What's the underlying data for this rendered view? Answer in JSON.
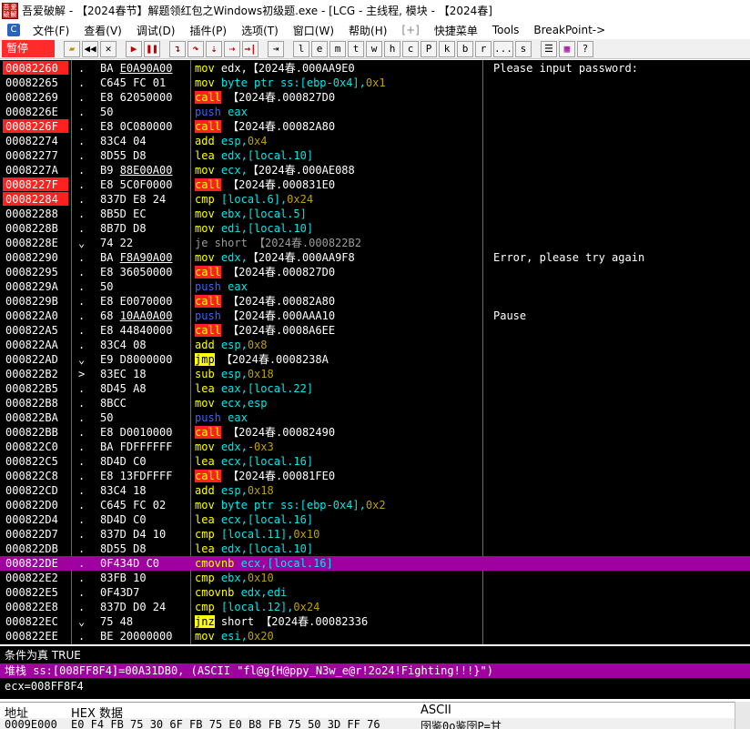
{
  "window": {
    "title": "吾爱破解 - 【2024春节】解题领红包之Windows初级题.exe - [LCG - 主线程, 模块 - 【2024春]",
    "logo_text": [
      "吾",
      "爱",
      "破",
      "解"
    ]
  },
  "menu": {
    "items": [
      "文件(F)",
      "查看(V)",
      "调试(D)",
      "插件(P)",
      "选项(T)",
      "窗口(W)",
      "帮助(H)",
      "[+]",
      "快捷菜单",
      "Tools",
      "BreakPoint->"
    ]
  },
  "toolbar": {
    "status": "暂停",
    "letters": [
      "l",
      "e",
      "m",
      "t",
      "w",
      "h",
      "c",
      "P",
      "k",
      "b",
      "r",
      "...",
      "s"
    ]
  },
  "disasm": {
    "rows": [
      {
        "addr": "00082260",
        "mark": ".",
        "hex": "BA E0A90A00",
        "hex_u": "E0A90A00",
        "mn": "mov",
        "mcls": "",
        "ops": [
          [
            "edx,",
            "w"
          ],
          [
            "【2024春.000AA9E0",
            "w"
          ]
        ],
        "comment": "Please input password:",
        "bp": true
      },
      {
        "addr": "00082265",
        "mark": ".",
        "hex": "C645 FC 01",
        "mn": "mov",
        "mcls": "",
        "ops": [
          [
            "byte ptr ss:[ebp-0x4],",
            "o"
          ],
          [
            "0x1",
            "n"
          ]
        ],
        "comment": ""
      },
      {
        "addr": "00082269",
        "mark": ".",
        "hex": "E8 62050000",
        "mn": "call",
        "mcls": "call",
        "ops": [
          [
            "【2024春.000827D0",
            "w"
          ]
        ],
        "comment": ""
      },
      {
        "addr": "0008226E",
        "mark": ".",
        "hex": "50",
        "mn": "push",
        "mcls": "push",
        "ops": [
          [
            "eax",
            "o"
          ]
        ],
        "comment": ""
      },
      {
        "addr": "0008226F",
        "mark": ".",
        "hex": "E8 0C080000",
        "mn": "call",
        "mcls": "call",
        "ops": [
          [
            "【2024春.00082A80",
            "w"
          ]
        ],
        "comment": "",
        "bp": true
      },
      {
        "addr": "00082274",
        "mark": ".",
        "hex": "83C4 04",
        "mn": "add",
        "mcls": "",
        "ops": [
          [
            "esp,",
            "o"
          ],
          [
            "0x4",
            "n"
          ]
        ],
        "comment": ""
      },
      {
        "addr": "00082277",
        "mark": ".",
        "hex": "8D55 D8",
        "mn": "lea",
        "mcls": "",
        "ops": [
          [
            "edx,[local.10]",
            "o"
          ]
        ],
        "comment": ""
      },
      {
        "addr": "0008227A",
        "mark": ".",
        "hex": "B9 88E00A00",
        "hex_u": "88E00A00",
        "mn": "mov",
        "mcls": "",
        "ops": [
          [
            "ecx,",
            "o"
          ],
          [
            "【2024春.000AE088",
            "w"
          ]
        ],
        "comment": ""
      },
      {
        "addr": "0008227F",
        "mark": ".",
        "hex": "E8 5C0F0000",
        "mn": "call",
        "mcls": "call",
        "ops": [
          [
            "【2024春.000831E0",
            "w"
          ]
        ],
        "comment": "",
        "bp": true
      },
      {
        "addr": "00082284",
        "mark": ".",
        "hex": "837D E8 24",
        "mn": "cmp",
        "mcls": "",
        "ops": [
          [
            "[local.6],",
            "o"
          ],
          [
            "0x24",
            "n"
          ]
        ],
        "comment": "",
        "bp": true
      },
      {
        "addr": "00082288",
        "mark": ".",
        "hex": "8B5D EC",
        "mn": "mov",
        "mcls": "",
        "ops": [
          [
            "ebx,[local.5]",
            "o"
          ]
        ],
        "comment": ""
      },
      {
        "addr": "0008228B",
        "mark": ".",
        "hex": "8B7D D8",
        "mn": "mov",
        "mcls": "",
        "ops": [
          [
            "edi,[local.10]",
            "o"
          ]
        ],
        "comment": ""
      },
      {
        "addr": "0008228E",
        "mark": "⌄",
        "hex": "74 22",
        "mn": "je short",
        "mcls": "je",
        "ops": [
          [
            "【2024春.000822B2",
            "g"
          ]
        ],
        "comment": ""
      },
      {
        "addr": "00082290",
        "mark": ".",
        "hex": "BA F8A90A00",
        "hex_u": "F8A90A00",
        "mn": "mov",
        "mcls": "",
        "ops": [
          [
            "edx,",
            "o"
          ],
          [
            "【2024春.000AA9F8",
            "w"
          ]
        ],
        "comment": "Error, please try again"
      },
      {
        "addr": "00082295",
        "mark": ".",
        "hex": "E8 36050000",
        "mn": "call",
        "mcls": "call",
        "ops": [
          [
            "【2024春.000827D0",
            "w"
          ]
        ],
        "comment": ""
      },
      {
        "addr": "0008229A",
        "mark": ".",
        "hex": "50",
        "mn": "push",
        "mcls": "push",
        "ops": [
          [
            "eax",
            "o"
          ]
        ],
        "comment": ""
      },
      {
        "addr": "0008229B",
        "mark": ".",
        "hex": "E8 E0070000",
        "mn": "call",
        "mcls": "call",
        "ops": [
          [
            "【2024春.00082A80",
            "w"
          ]
        ],
        "comment": ""
      },
      {
        "addr": "000822A0",
        "mark": ".",
        "hex": "68 10AA0A00",
        "hex_u": "10AA0A00",
        "mn": "push",
        "mcls": "push",
        "ops": [
          [
            "【2024春.000AAA10",
            "w"
          ]
        ],
        "comment": "Pause"
      },
      {
        "addr": "000822A5",
        "mark": ".",
        "hex": "E8 44840000",
        "mn": "call",
        "mcls": "call",
        "ops": [
          [
            "【2024春.0008A6EE",
            "w"
          ]
        ],
        "comment": ""
      },
      {
        "addr": "000822AA",
        "mark": ".",
        "hex": "83C4 08",
        "mn": "add",
        "mcls": "",
        "ops": [
          [
            "esp,",
            "o"
          ],
          [
            "0x8",
            "n"
          ]
        ],
        "comment": ""
      },
      {
        "addr": "000822AD",
        "mark": "⌄",
        "hex": "E9 D8000000",
        "mn": "jmp",
        "mcls": "jmp",
        "ops": [
          [
            "【2024春.0008238A",
            "w"
          ]
        ],
        "comment": ""
      },
      {
        "addr": "000822B2",
        "mark": ">",
        "hex": "83EC 18",
        "mn": "sub",
        "mcls": "",
        "ops": [
          [
            "esp,",
            "o"
          ],
          [
            "0x18",
            "n"
          ]
        ],
        "comment": ""
      },
      {
        "addr": "000822B5",
        "mark": ".",
        "hex": "8D45 A8",
        "mn": "lea",
        "mcls": "",
        "ops": [
          [
            "eax,[local.22]",
            "o"
          ]
        ],
        "comment": ""
      },
      {
        "addr": "000822B8",
        "mark": ".",
        "hex": "8BCC",
        "mn": "mov",
        "mcls": "",
        "ops": [
          [
            "ecx,esp",
            "o"
          ]
        ],
        "comment": ""
      },
      {
        "addr": "000822BA",
        "mark": ".",
        "hex": "50",
        "mn": "push",
        "mcls": "push",
        "ops": [
          [
            "eax",
            "o"
          ]
        ],
        "comment": ""
      },
      {
        "addr": "000822BB",
        "mark": ".",
        "hex": "E8 D0010000",
        "mn": "call",
        "mcls": "call",
        "ops": [
          [
            "【2024春.00082490",
            "w"
          ]
        ],
        "comment": ""
      },
      {
        "addr": "000822C0",
        "mark": ".",
        "hex": "BA FDFFFFFF",
        "mn": "mov",
        "mcls": "",
        "ops": [
          [
            "edx,",
            "o"
          ],
          [
            "-0x3",
            "n"
          ]
        ],
        "comment": ""
      },
      {
        "addr": "000822C5",
        "mark": ".",
        "hex": "8D4D C0",
        "mn": "lea",
        "mcls": "",
        "ops": [
          [
            "ecx,[local.16]",
            "o"
          ]
        ],
        "comment": ""
      },
      {
        "addr": "000822C8",
        "mark": ".",
        "hex": "E8 13FDFFFF",
        "mn": "call",
        "mcls": "call",
        "ops": [
          [
            "【2024春.00081FE0",
            "w"
          ]
        ],
        "comment": ""
      },
      {
        "addr": "000822CD",
        "mark": ".",
        "hex": "83C4 18",
        "mn": "add",
        "mcls": "",
        "ops": [
          [
            "esp,",
            "o"
          ],
          [
            "0x18",
            "n"
          ]
        ],
        "comment": ""
      },
      {
        "addr": "000822D0",
        "mark": ".",
        "hex": "C645 FC 02",
        "mn": "mov",
        "mcls": "",
        "ops": [
          [
            "byte ptr ss:[ebp-0x4],",
            "o"
          ],
          [
            "0x2",
            "n"
          ]
        ],
        "comment": ""
      },
      {
        "addr": "000822D4",
        "mark": ".",
        "hex": "8D4D C0",
        "mn": "lea",
        "mcls": "",
        "ops": [
          [
            "ecx,[local.16]",
            "o"
          ]
        ],
        "comment": ""
      },
      {
        "addr": "000822D7",
        "mark": ".",
        "hex": "837D D4 10",
        "mn": "cmp",
        "mcls": "",
        "ops": [
          [
            "[local.11],",
            "o"
          ],
          [
            "0x10",
            "n"
          ]
        ],
        "comment": ""
      },
      {
        "addr": "000822DB",
        "mark": ".",
        "hex": "8D55 D8",
        "mn": "lea",
        "mcls": "",
        "ops": [
          [
            "edx,[local.10]",
            "o"
          ]
        ],
        "comment": ""
      },
      {
        "addr": "000822DE",
        "mark": ".",
        "hex": "0F434D C0",
        "mn": "cmovnb",
        "mcls": "",
        "ops": [
          [
            "ecx,[local.16]",
            "o"
          ]
        ],
        "comment": "",
        "sel": true
      },
      {
        "addr": "000822E2",
        "mark": ".",
        "hex": "83FB 10",
        "mn": "cmp",
        "mcls": "",
        "ops": [
          [
            "ebx,",
            "o"
          ],
          [
            "0x10",
            "n"
          ]
        ],
        "comment": ""
      },
      {
        "addr": "000822E5",
        "mark": ".",
        "hex": "0F43D7",
        "mn": "cmovnb",
        "mcls": "",
        "ops": [
          [
            "edx,edi",
            "o"
          ]
        ],
        "comment": ""
      },
      {
        "addr": "000822E8",
        "mark": ".",
        "hex": "837D D0 24",
        "mn": "cmp",
        "mcls": "",
        "ops": [
          [
            "[local.12],",
            "o"
          ],
          [
            "0x24",
            "n"
          ]
        ],
        "comment": ""
      },
      {
        "addr": "000822EC",
        "mark": "⌄",
        "hex": "75 48",
        "mn": "jnz",
        "mcls": "jcc",
        "ops": [
          [
            "short 【2024春.00082336",
            "w"
          ]
        ],
        "comment": ""
      },
      {
        "addr": "000822EE",
        "mark": ".",
        "hex": "BE 20000000",
        "mn": "mov",
        "mcls": "",
        "ops": [
          [
            "esi,",
            "o"
          ],
          [
            "0x20",
            "n"
          ]
        ],
        "comment": ""
      }
    ]
  },
  "info": {
    "condition": "条件为真 TRUE",
    "stack": "堆栈 ss:[008FF8F4]=00A31DB0, (ASCII \"fl@g{H@ppy_N3w_e@r!2o24!Fighting!!!}\")",
    "ecx": "ecx=008FF8F4"
  },
  "dump": {
    "col_addr": "地址",
    "col_hex": "HEX 数据",
    "col_ascii": "ASCII",
    "row_addr": "0009E000",
    "row_hex": "E0 F4 FB 75 30 6F FB 75 E0 B8 FB 75 50 3D FF 76",
    "row_ascii": "囹鉴0o鉴囹P=甘"
  },
  "colors": {
    "breakpoint": "#ff2020",
    "selection": "#a000a0",
    "mnemonic": "#ffff00",
    "operand": "#00e8e8"
  }
}
